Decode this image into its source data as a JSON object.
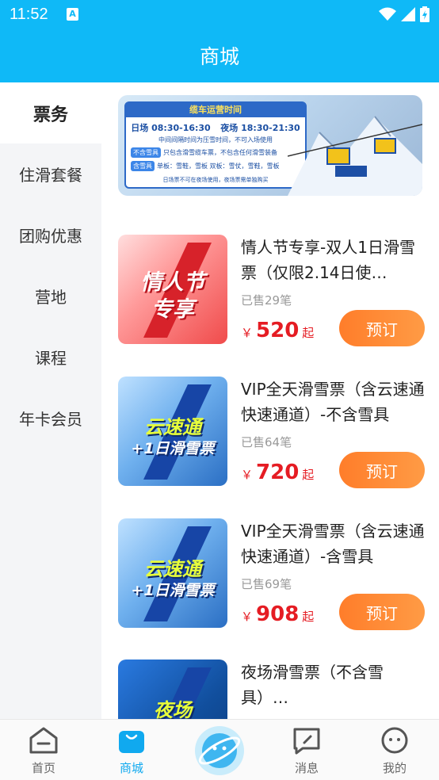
{
  "status_bar": {
    "time": "11:52",
    "sim_label": "A"
  },
  "header": {
    "title": "商城"
  },
  "sidebar": {
    "items": [
      {
        "label": "票务",
        "active": true
      },
      {
        "label": "住滑套餐"
      },
      {
        "label": "团购优惠"
      },
      {
        "label": "营地"
      },
      {
        "label": "课程"
      },
      {
        "label": "年卡会员"
      }
    ]
  },
  "banner": {
    "heading": "缆车运营时间",
    "day_label": "日场 08:30-16:30",
    "night_label": "夜场 18:30-21:30",
    "tip": "中间间隔时间为压雪时间，不可入场使用",
    "tag1": "不含雪具",
    "tag1_text": "只包含滑雪缆车票，不包含任何滑雪装备",
    "tag2": "含雪具",
    "tag2_text": "单板：雪鞋，雪板      双板：雪仗，雪鞋，雪板",
    "footer": "日场票不可在夜场使用，夜场票需单独购买"
  },
  "products": [
    {
      "name": "情人节专享-双人1日滑雪票（仅限2.14日使…",
      "sold": "已售29笔",
      "currency": "￥",
      "price": "520",
      "price_suffix": "起",
      "book_label": "预订",
      "thumb_line1": "情人节",
      "thumb_line2": "专享"
    },
    {
      "name": "VIP全天滑雪票（含云速通快速通道）-不含雪具",
      "sold": "已售64笔",
      "currency": "￥",
      "price": "720",
      "price_suffix": "起",
      "book_label": "预订",
      "thumb_line1": "云速通",
      "thumb_line2": "+1日滑雪票"
    },
    {
      "name": "VIP全天滑雪票（含云速通快速通道）-含雪具",
      "sold": "已售69笔",
      "currency": "￥",
      "price": "908",
      "price_suffix": "起",
      "book_label": "预订",
      "thumb_line1": "云速通",
      "thumb_line2": "+1日滑雪票"
    },
    {
      "name": "夜场滑雪票（不含雪具）…",
      "thumb_line1": "夜场"
    }
  ],
  "bottom_nav": {
    "items": [
      {
        "label": "首页",
        "icon": "home-icon"
      },
      {
        "label": "商城",
        "icon": "shop-bag-icon",
        "active": true
      },
      {
        "label": "",
        "icon": "planet-icon"
      },
      {
        "label": "消息",
        "icon": "message-icon"
      },
      {
        "label": "我的",
        "icon": "profile-face-icon"
      }
    ]
  },
  "colors": {
    "header": "#0fb9f7",
    "accent_orange": "#ff8a36",
    "price_red": "#e51c23",
    "nav_active": "#10a9ef"
  }
}
